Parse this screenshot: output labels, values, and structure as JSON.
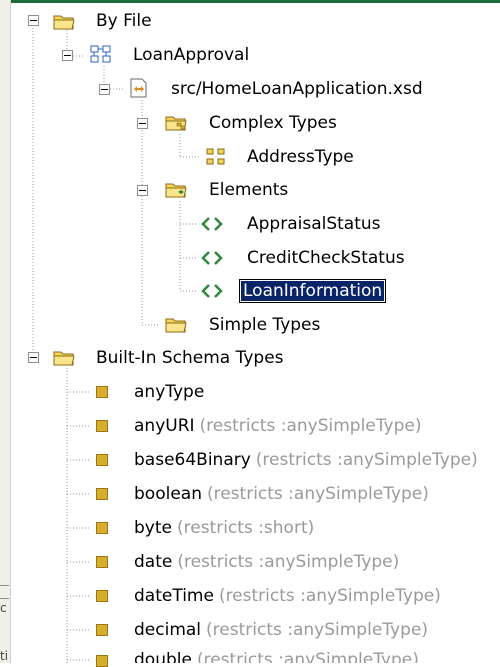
{
  "tree": {
    "by_file": "By File",
    "loan_approval": "LoanApproval",
    "xsd_file": "src/HomeLoanApplication.xsd",
    "complex_types": "Complex Types",
    "address_type": "AddressType",
    "elements": "Elements",
    "appraisal_status": "AppraisalStatus",
    "credit_check_status": "CreditCheckStatus",
    "loan_information": "LoanInformation",
    "simple_types": "Simple Types",
    "builtin_types": "Built-In Schema Types",
    "types": [
      {
        "name": "anyType",
        "note": ""
      },
      {
        "name": "anyURI",
        "note": "(restricts :anySimpleType)"
      },
      {
        "name": "base64Binary",
        "note": "(restricts :anySimpleType)"
      },
      {
        "name": "boolean",
        "note": "(restricts :anySimpleType)"
      },
      {
        "name": "byte",
        "note": "(restricts :short)"
      },
      {
        "name": "date",
        "note": "(restricts :anySimpleType)"
      },
      {
        "name": "dateTime",
        "note": "(restricts :anySimpleType)"
      },
      {
        "name": "decimal",
        "note": "(restricts :anySimpleType)"
      },
      {
        "name": "double",
        "note": "(restricts :anySimpleType)"
      }
    ]
  },
  "left_strip": [
    "c",
    "ti"
  ]
}
